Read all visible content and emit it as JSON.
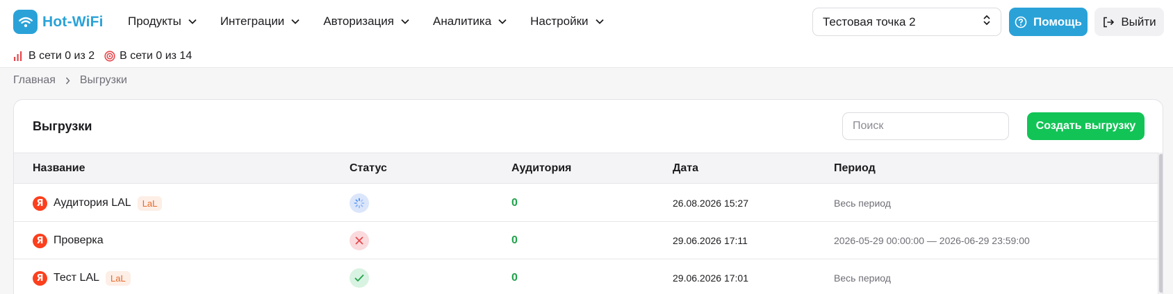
{
  "app": {
    "logo_text": "Hot-WiFi"
  },
  "nav": {
    "items": [
      {
        "label": "Продукты"
      },
      {
        "label": "Интеграции"
      },
      {
        "label": "Авторизация"
      },
      {
        "label": "Аналитика"
      },
      {
        "label": "Настройки"
      }
    ]
  },
  "header": {
    "point_select": "Тестовая точка 2",
    "help_label": "Помощь",
    "logout_label": "Выйти"
  },
  "status": {
    "routers": "В сети 0 из 2",
    "sensors": "В сети 0 из 14"
  },
  "breadcrumb": {
    "home": "Главная",
    "current": "Выгрузки"
  },
  "card": {
    "title": "Выгрузки",
    "search_placeholder": "Поиск",
    "create_label": "Создать выгрузку"
  },
  "table": {
    "columns": {
      "name": "Название",
      "status": "Статус",
      "audience": "Аудитория",
      "date": "Дата",
      "period": "Период"
    },
    "rows": [
      {
        "name": "Аудитория LAL",
        "badge": "LaL",
        "status": "in-progress",
        "audience": "0",
        "date": "26.08.2026 15:27",
        "period": "Весь период"
      },
      {
        "name": "Проверка",
        "badge": "",
        "status": "error",
        "audience": "0",
        "date": "29.06.2026 17:11",
        "period": "2026-05-29 00:00:00 — 2026-06-29 23:59:00"
      },
      {
        "name": "Тест LAL",
        "badge": "LaL",
        "status": "success",
        "audience": "0",
        "date": "29.06.2026 17:01",
        "period": "Весь период"
      }
    ]
  },
  "colors": {
    "brand": "#2aa2d8",
    "create": "#12c456",
    "audience": "#1fa24a",
    "yandex": "#fc3f1d"
  },
  "icons": {
    "status_in_progress": "spinner-icon",
    "status_error": "cross-icon",
    "status_success": "check-icon",
    "source": "yandex-icon"
  }
}
